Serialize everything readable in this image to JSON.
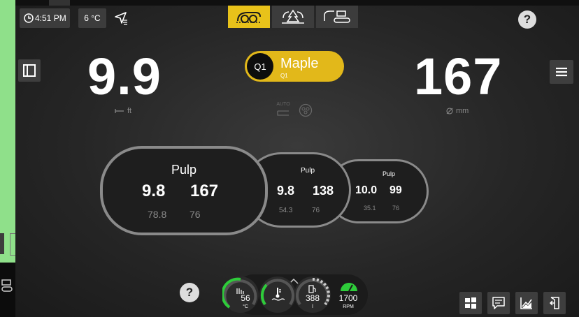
{
  "status": {
    "time": "4:51 PM",
    "temperature": "6 °C"
  },
  "modes": [
    "harvester-head-icon",
    "tree-felling-icon",
    "forwarder-icon"
  ],
  "help_label": "?",
  "species": {
    "qualifier": "Q1",
    "name": "Maple",
    "sub": "Q1"
  },
  "length": {
    "value": "9.9",
    "unit": "ft"
  },
  "diameter": {
    "value": "167",
    "unit": "mm"
  },
  "auto_label": "AUTO",
  "logs": [
    {
      "assortment": "Pulp",
      "length": "9.8",
      "diameter": "167",
      "sub_a": "78.8",
      "sub_b": "76"
    },
    {
      "assortment": "Pulp",
      "length": "9.8",
      "diameter": "138",
      "sub_a": "54.3",
      "sub_b": "76"
    },
    {
      "assortment": "Pulp",
      "length": "10.0",
      "diameter": "99",
      "sub_a": "35.1",
      "sub_b": "76"
    }
  ],
  "gauges": {
    "oil_temp": {
      "value": "56",
      "unit": "°C"
    },
    "coolant": {
      "value": ""
    },
    "fuel": {
      "value": "388",
      "unit": "l"
    },
    "engine": {
      "value": "1700",
      "unit": "RPM"
    }
  },
  "colors": {
    "accent": "#e8c21a",
    "gauge_green": "#2ecc3a",
    "left_strip": "#8fe08a"
  }
}
